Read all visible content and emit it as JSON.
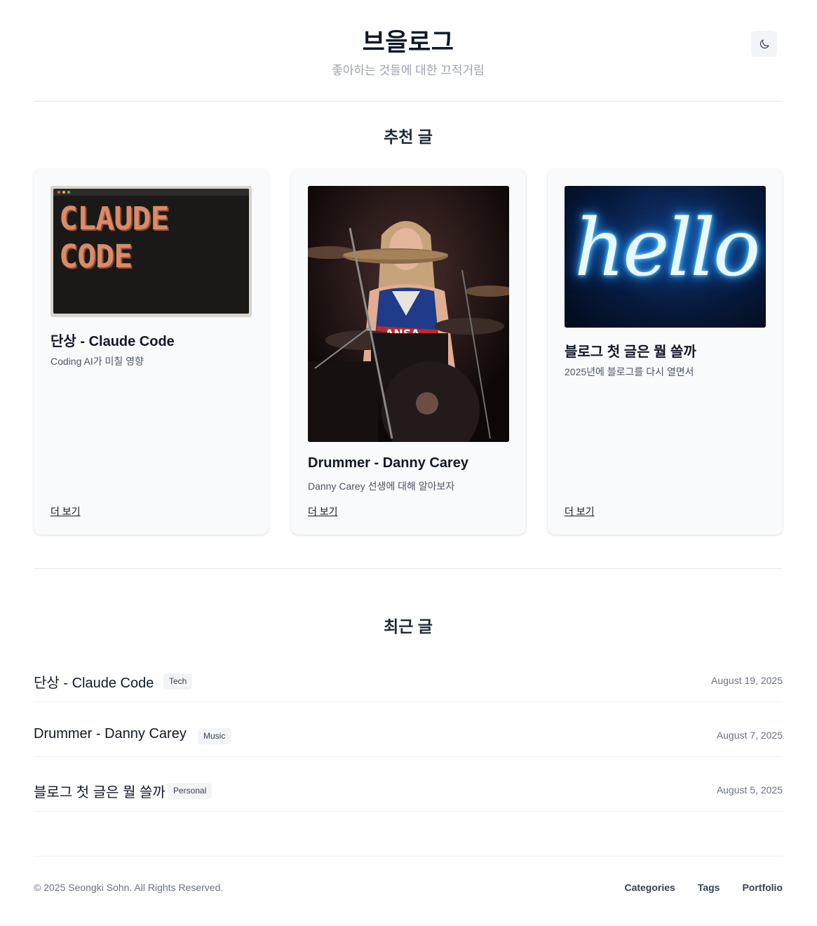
{
  "header": {
    "title": "브을로그",
    "subtitle": "좋아하는 것들에 대한 끄적거림",
    "theme_toggle_icon": "moon-icon"
  },
  "featured": {
    "heading": "추천 글",
    "cards": [
      {
        "title": "단상 - Claude Code",
        "description": "Coding AI가 미칠 영향",
        "more": "더 보기",
        "image_text_line1": "CLAUDE",
        "image_text_line2": "CODE"
      },
      {
        "title": "Drummer - Danny Carey",
        "description": "Danny Carey 선생에 대해 알아보자",
        "more": "더 보기"
      },
      {
        "title": "블로그 첫 글은 뭘 쓸까",
        "description": "2025년에 블로그를 다시 열면서",
        "more": "더 보기",
        "image_text": "hello"
      }
    ]
  },
  "recent": {
    "heading": "최근 글",
    "posts": [
      {
        "title": "단상 - Claude Code",
        "tag": "Tech",
        "date": "August 19, 2025"
      },
      {
        "title": "Drummer - Danny Carey",
        "tag": "Music",
        "date": "August 7, 2025"
      },
      {
        "title": "블로그 첫 글은 뭘 쓸까",
        "tag": "Personal",
        "date": "August 5, 2025"
      }
    ]
  },
  "footer": {
    "copyright": "© 2025 Seongki Sohn. All Rights Reserved.",
    "links": [
      "Categories",
      "Tags",
      "Portfolio"
    ]
  },
  "colors": {
    "text": "#111827",
    "muted": "#6b7280",
    "card_bg": "#f9fafb",
    "claude_orange": "#d98b6a",
    "neon_blue": "#6fd3ff"
  }
}
